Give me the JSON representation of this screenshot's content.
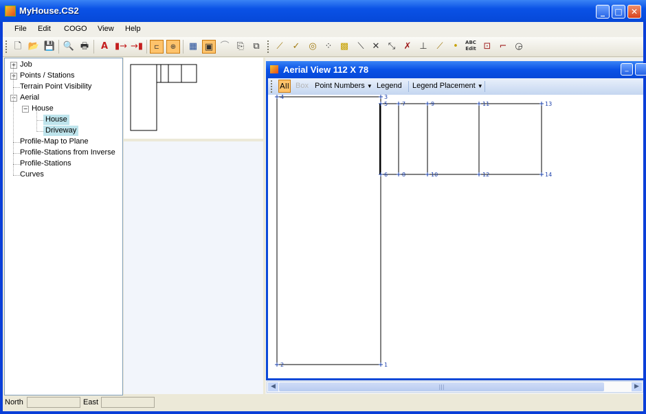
{
  "window": {
    "title": "MyHouse.CS2"
  },
  "menu": [
    "File",
    "Edit",
    "COGO",
    "View",
    "Help"
  ],
  "tree": {
    "items": [
      {
        "label": "Job",
        "expander": "+"
      },
      {
        "label": "Points / Stations",
        "expander": "+"
      },
      {
        "label": "Terrain Point Visibility",
        "expander": ""
      },
      {
        "label": "Aerial",
        "expander": "−"
      },
      {
        "label": "House",
        "expander": "−"
      },
      {
        "label": "House",
        "expander": "",
        "selected": true
      },
      {
        "label": "Driveway",
        "expander": "",
        "selected": true
      },
      {
        "label": "Profile-Map to Plane",
        "expander": ""
      },
      {
        "label": "Profile-Stations from Inverse",
        "expander": ""
      },
      {
        "label": "Profile-Stations",
        "expander": ""
      },
      {
        "label": "Curves",
        "expander": ""
      }
    ]
  },
  "child_window": {
    "title": "Aerial View   112  X  78",
    "toolbar": {
      "all": "All",
      "box": "Box",
      "point_numbers": "Point Numbers",
      "legend": "Legend",
      "legend_placement": "Legend Placement"
    }
  },
  "drawing": {
    "point_labels": [
      "1",
      "2",
      "3",
      "4",
      "5",
      "6",
      "7",
      "8",
      "9",
      "10",
      "11",
      "12",
      "13",
      "14"
    ],
    "line_color": "#000000",
    "label_color": "#1a3faa"
  },
  "status": {
    "north_label": "North",
    "east_label": "East",
    "north_value": "",
    "east_value": ""
  },
  "colors": {
    "title_blue": "#0a52e6",
    "selected_tree": "#bee4ec",
    "active_tool": "#ffc36b"
  }
}
